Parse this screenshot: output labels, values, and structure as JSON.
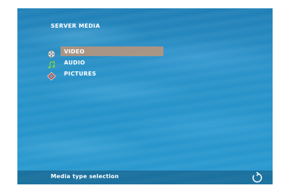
{
  "header": {
    "title": "SERVER MEDIA"
  },
  "menu": {
    "items": [
      {
        "label": "VIDEO",
        "icon": "film-reel-icon",
        "selected": true
      },
      {
        "label": "AUDIO",
        "icon": "music-note-icon",
        "selected": false
      },
      {
        "label": "PICTURES",
        "icon": "picture-icon",
        "selected": false
      }
    ]
  },
  "status_bar": {
    "text": "Media type selection",
    "back_icon": "back-arrow-icon"
  },
  "colors": {
    "background": "#2593c9",
    "highlight": "#d2966e",
    "text": "#ffffff",
    "audio_icon": "#7fd04a"
  }
}
